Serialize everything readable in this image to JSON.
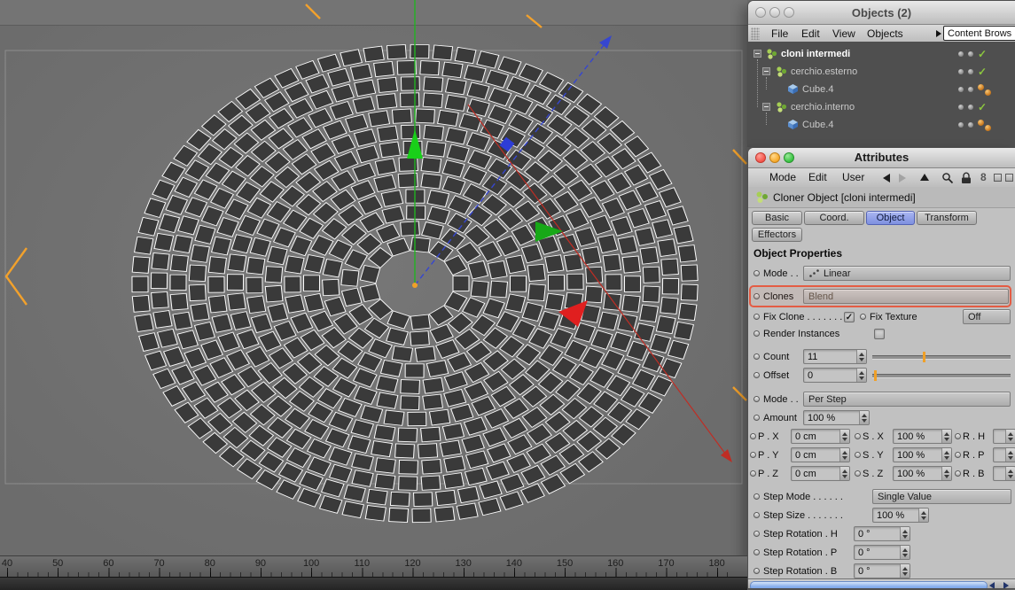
{
  "viewport": {
    "ruler": [
      "40",
      "50",
      "60",
      "70",
      "80",
      "90",
      "100",
      "110",
      "120",
      "130",
      "140",
      "150",
      "160",
      "170",
      "180"
    ]
  },
  "objects": {
    "title": "Objects (2)",
    "menu": [
      "File",
      "Edit",
      "View",
      "Objects"
    ],
    "content_browser": "Content Brows",
    "check_glyph": "✓",
    "tree": [
      {
        "label": "cloni intermedi"
      },
      {
        "label": "cerchio.esterno"
      },
      {
        "label": "Cube.4"
      },
      {
        "label": "cerchio.interno"
      },
      {
        "label": "Cube.4"
      }
    ]
  },
  "attributes": {
    "title": "Attributes",
    "menu": [
      "Mode",
      "Edit",
      "User"
    ],
    "link_icon": "8",
    "object_header": "Cloner Object [cloni intermedi]",
    "tabs": [
      "Basic",
      "Coord.",
      "Object",
      "Transform",
      "Effectors"
    ],
    "section": "Object Properties",
    "check_glyph": "✓",
    "mode_label": "Mode . .",
    "mode_value": "Linear",
    "clones_label": "Clones",
    "clones_value": "Blend",
    "fix_clone_label": "Fix Clone . . . . . . .",
    "fix_texture_label": "Fix Texture",
    "fix_texture_value": "Off",
    "render_instances_label": "Render Instances",
    "count_label": "Count",
    "count_value": "11",
    "offset_label": "Offset",
    "offset_value": "0",
    "mode2_label": "Mode . .",
    "mode2_value": "Per Step",
    "amount_label": "Amount",
    "amount_value": "100 %",
    "psr": [
      {
        "p": "P . X",
        "pv": "0 cm",
        "s": "S . X",
        "sv": "100 %",
        "r": "R . H"
      },
      {
        "p": "P . Y",
        "pv": "0 cm",
        "s": "S . Y",
        "sv": "100 %",
        "r": "R . P"
      },
      {
        "p": "P . Z",
        "pv": "0 cm",
        "s": "S . Z",
        "sv": "100 %",
        "r": "R . B"
      }
    ],
    "step_mode_label": "Step Mode . . . . . .",
    "step_mode_value": "Single Value",
    "step_size_label": "Step Size . . . . . . .",
    "step_size_value": "100 %",
    "step_rot": [
      {
        "label": "Step Rotation . H",
        "value": "0 °"
      },
      {
        "label": "Step Rotation . P",
        "value": "0 °"
      },
      {
        "label": "Step Rotation . B",
        "value": "0 °"
      }
    ]
  }
}
